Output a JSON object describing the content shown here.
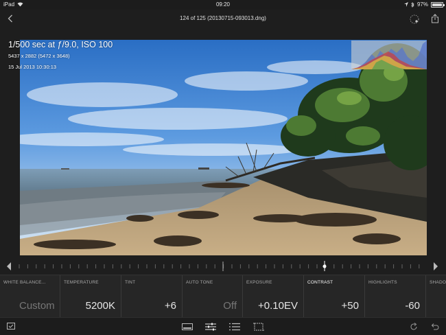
{
  "status_bar": {
    "device": "iPad",
    "time": "09:20",
    "battery": "97%",
    "battery_fraction": 0.97
  },
  "header": {
    "title": "124 of 125 (20130715-093013.dng)",
    "icons": [
      "back-chevron-icon",
      "activity-spinner-icon",
      "share-icon"
    ]
  },
  "photo_info": {
    "exposure": "1/500 sec at ƒ/9.0, ISO 100",
    "dimensions": "5437 x 2882 (5472 x 3648)",
    "date": "15 Jul 2013 10:30:13"
  },
  "adjustments": [
    {
      "label": "WHITE BALANCE...",
      "value": "Custom",
      "dim": true
    },
    {
      "label": "TEMPERATURE",
      "value": "5200K",
      "dim": false
    },
    {
      "label": "TINT",
      "value": "+6",
      "dim": false
    },
    {
      "label": "AUTO TONE",
      "value": "Off",
      "dim": true
    },
    {
      "label": "EXPOSURE",
      "value": "+0.10EV",
      "dim": false
    },
    {
      "label": "CONTRAST",
      "value": "+50",
      "dim": false,
      "active": true
    },
    {
      "label": "HIGHLIGHTS",
      "value": "-60",
      "dim": false
    },
    {
      "label": "SHADO",
      "value": "",
      "dim": false
    }
  ],
  "toolbar": {
    "icons": [
      "flag-icon",
      "filmstrip-icon",
      "sliders-icon",
      "presets-list-icon",
      "crop-icon",
      "redo-icon",
      "undo-icon"
    ]
  },
  "colors": {
    "background": "#1e1e1e",
    "panel": "#262626",
    "text": "#e6e6e6",
    "label": "#aaaaaa"
  }
}
